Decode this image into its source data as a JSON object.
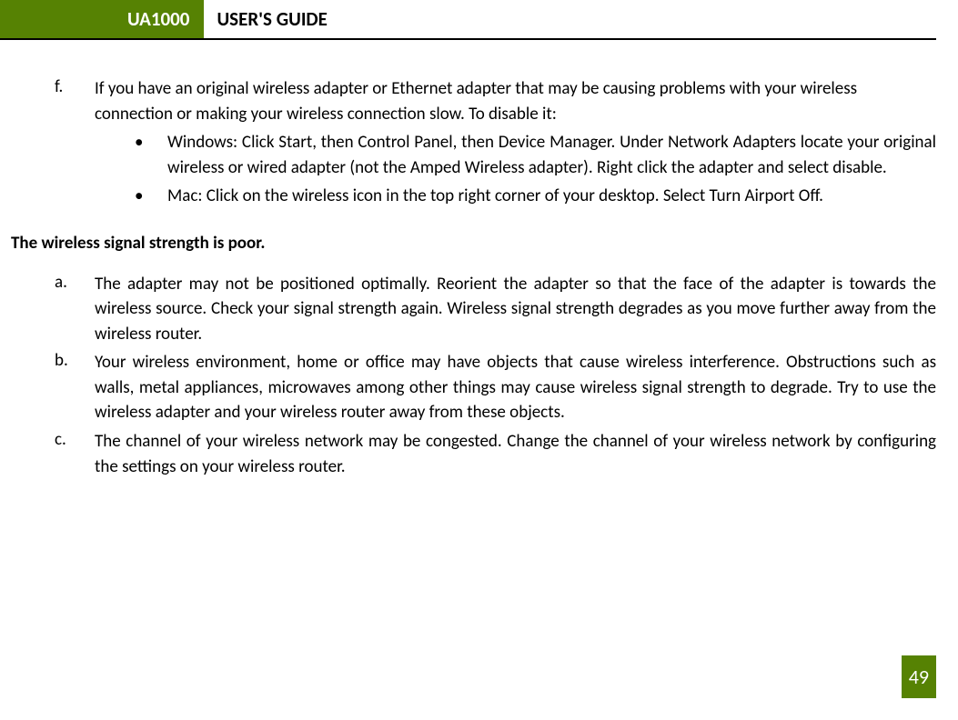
{
  "header": {
    "badge": "UA1000",
    "title": "USER'S GUIDE"
  },
  "itemF": {
    "letter": "f.",
    "text": "If you have an original wireless adapter or Ethernet adapter that may be causing problems with your wireless connection or making your wireless connection slow. To disable it:",
    "sub1": "Windows: Click Start, then Control Panel, then Device Manager. Under Network Adapters locate your original wireless or wired adapter (not the Amped Wireless adapter). Right click the adapter and select disable.",
    "sub2": "Mac: Click on the wireless icon in the top right corner of your desktop. Select Turn Airport Off."
  },
  "heading": "The wireless signal strength is poor.",
  "items": {
    "a": {
      "letter": "a.",
      "text": "The adapter may not be positioned optimally. Reorient the adapter so that the face of the adapter is towards the wireless source. Check your signal strength again. Wireless signal strength degrades as you move further away from the wireless router."
    },
    "b": {
      "letter": "b.",
      "text": "Your wireless environment, home or office may have objects that cause wireless interference. Obstructions such as walls, metal appliances, microwaves among other things may cause wireless signal strength to degrade. Try to use the wireless adapter and your wireless router away from these objects."
    },
    "c": {
      "letter": "c.",
      "text": "The channel of your wireless network may be congested. Change the channel of your wireless network by configuring the settings on your wireless router."
    }
  },
  "pageNumber": "49",
  "bullet": "•"
}
